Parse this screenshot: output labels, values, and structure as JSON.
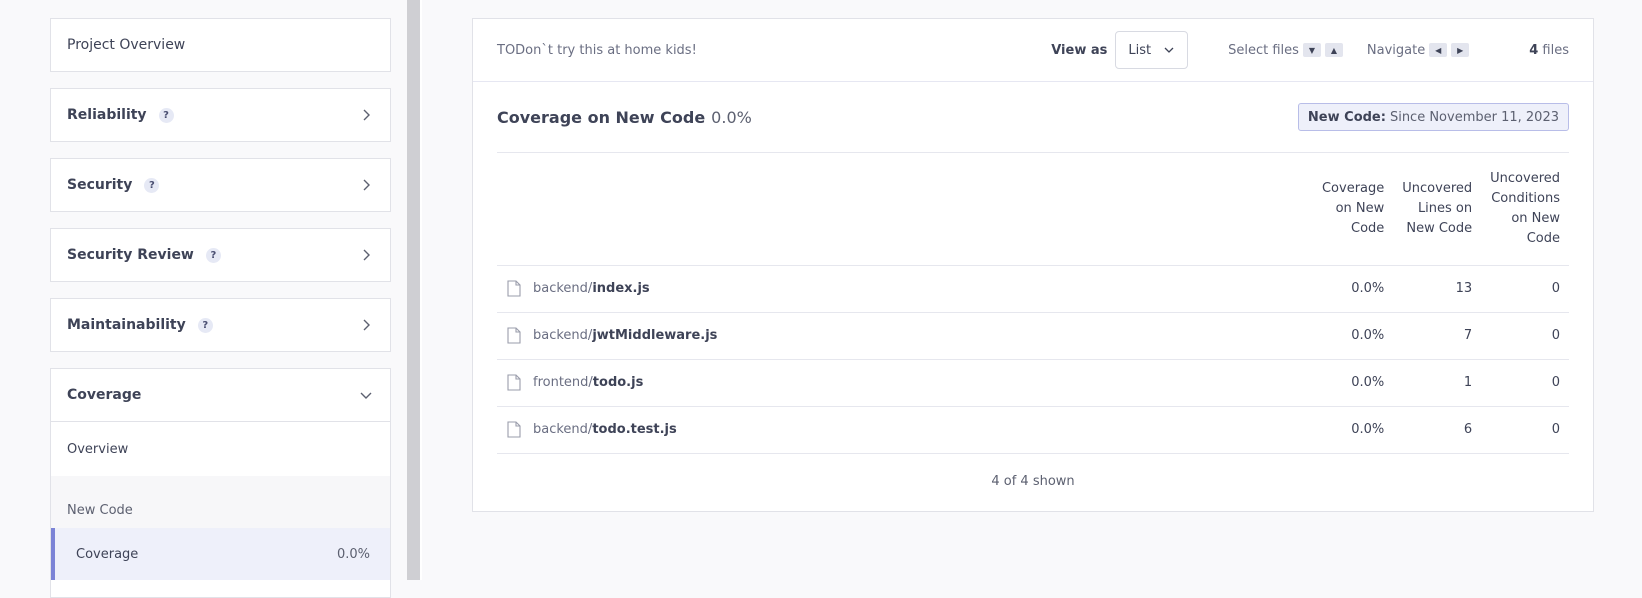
{
  "sidebar": {
    "project_overview": "Project Overview",
    "help_mark": "?",
    "sections": [
      {
        "label": "Reliability"
      },
      {
        "label": "Security"
      },
      {
        "label": "Security Review"
      },
      {
        "label": "Maintainability"
      }
    ],
    "coverage": {
      "label": "Coverage",
      "overview": "Overview",
      "new_code_label": "New Code",
      "selected_item": {
        "label": "Coverage",
        "value": "0.0%"
      }
    }
  },
  "toolbar": {
    "note": "TODon`t try this at home kids!",
    "view_as_label": "View as",
    "view_as_value": "List",
    "select_files_label": "Select files",
    "navigate_label": "Navigate",
    "file_count": "4",
    "files_label": "files"
  },
  "coverage_header": {
    "title": "Coverage on New Code",
    "value": "0.0%",
    "new_code_label": "New Code:",
    "new_code_value": "Since November 11, 2023"
  },
  "table": {
    "columns": [
      "Coverage on New Code",
      "Uncovered Lines on New Code",
      "Uncovered Conditions on New Code"
    ],
    "rows": [
      {
        "path": "backend/",
        "file": "index.js",
        "coverage": "0.0%",
        "lines": "13",
        "conditions": "0"
      },
      {
        "path": "backend/",
        "file": "jwtMiddleware.js",
        "coverage": "0.0%",
        "lines": "7",
        "conditions": "0"
      },
      {
        "path": "frontend/",
        "file": "todo.js",
        "coverage": "0.0%",
        "lines": "1",
        "conditions": "0"
      },
      {
        "path": "backend/",
        "file": "todo.test.js",
        "coverage": "0.0%",
        "lines": "6",
        "conditions": "0"
      }
    ],
    "footer": "4 of 4 shown"
  },
  "colors": {
    "accent": "#7b83d6",
    "selected_bg": "#eef0fa",
    "badge_border": "#b8bde8"
  }
}
